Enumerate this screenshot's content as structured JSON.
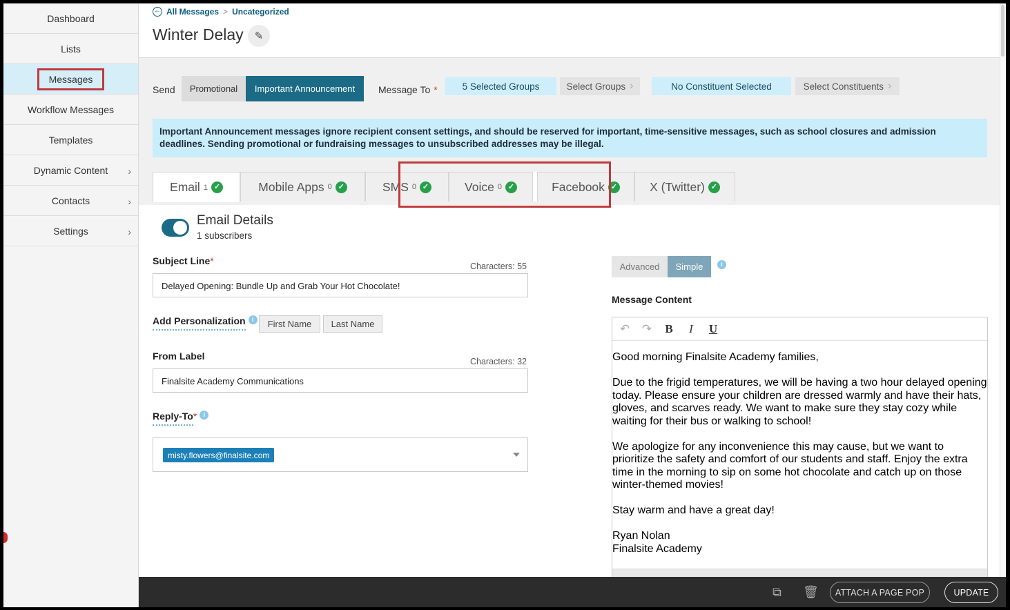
{
  "sidebar": {
    "items": [
      {
        "label": "Dashboard",
        "chevron": false
      },
      {
        "label": "Lists",
        "chevron": false
      },
      {
        "label": "Messages",
        "chevron": false,
        "active": true
      },
      {
        "label": "Workflow Messages",
        "chevron": false
      },
      {
        "label": "Templates",
        "chevron": false
      },
      {
        "label": "Dynamic Content",
        "chevron": true
      },
      {
        "label": "Contacts",
        "chevron": true
      },
      {
        "label": "Settings",
        "chevron": true
      }
    ]
  },
  "breadcrumb": {
    "root": "All Messages",
    "separator": ">",
    "current": "Uncategorized"
  },
  "page": {
    "title": "Winter Delay"
  },
  "send": {
    "label": "Send",
    "promotional": "Promotional",
    "important": "Important Announcement",
    "message_to": "Message To",
    "required_mark": "*",
    "selected_groups": "5 Selected Groups",
    "select_groups": "Select Groups",
    "no_constituent": "No Constituent Selected",
    "select_constituents": "Select Constituents"
  },
  "notice": "Important Announcement messages ignore recipient consent settings, and should be reserved for important, time-sensitive messages, such as school closures and admission deadlines. Sending promotional or fundraising messages to unsubscribed addresses may be illegal.",
  "tabs": [
    {
      "label": "Email",
      "count": "1"
    },
    {
      "label": "Mobile Apps",
      "count": "0"
    },
    {
      "label": "SMS",
      "count": "0"
    },
    {
      "label": "Voice",
      "count": "0"
    },
    {
      "label": "Facebook",
      "count": ""
    },
    {
      "label": "X (Twitter)",
      "count": ""
    }
  ],
  "email": {
    "details_title": "Email Details",
    "subscribers": "1 subscribers",
    "subject_label": "Subject Line",
    "subject_chars": "Characters: 55",
    "subject_value": "Delayed Opening: Bundle Up and Grab Your Hot Chocolate!",
    "personalization_label": "Add Personalization",
    "first_name": "First Name",
    "last_name": "Last Name",
    "from_label": "From Label",
    "from_chars": "Characters: 32",
    "from_value": "Finalsite Academy Communications",
    "reply_label": "Reply-To",
    "reply_value": "misty.flowers@finalsite.com"
  },
  "content": {
    "advanced": "Advanced",
    "simple": "Simple",
    "label": "Message Content",
    "p1": "Good morning Finalsite Academy families,",
    "p2": "Due to the frigid temperatures, we will be having a two hour delayed opening today. Please ensure your children are dressed warmly and have their hats, gloves, and scarves ready. We want to make sure they stay cozy while waiting for their bus or walking to school!",
    "p3": "We apologize for any inconvenience this may cause, but we want to prioritize the safety and comfort of our students and staff. Enjoy the extra time in the morning to sip on some hot chocolate and catch up on those winter-themed movies!",
    "p4": "Stay warm and have a great day!",
    "sig_name": "Ryan Nolan",
    "sig_org": "Finalsite Academy"
  },
  "footer": {
    "attach": "ATTACH A PAGE POP",
    "update": "UPDATE"
  },
  "colors": {
    "accent": "#1c6b86",
    "highlight": "#c0393b",
    "notice_bg": "#c9edfa",
    "check": "#27a04a"
  }
}
